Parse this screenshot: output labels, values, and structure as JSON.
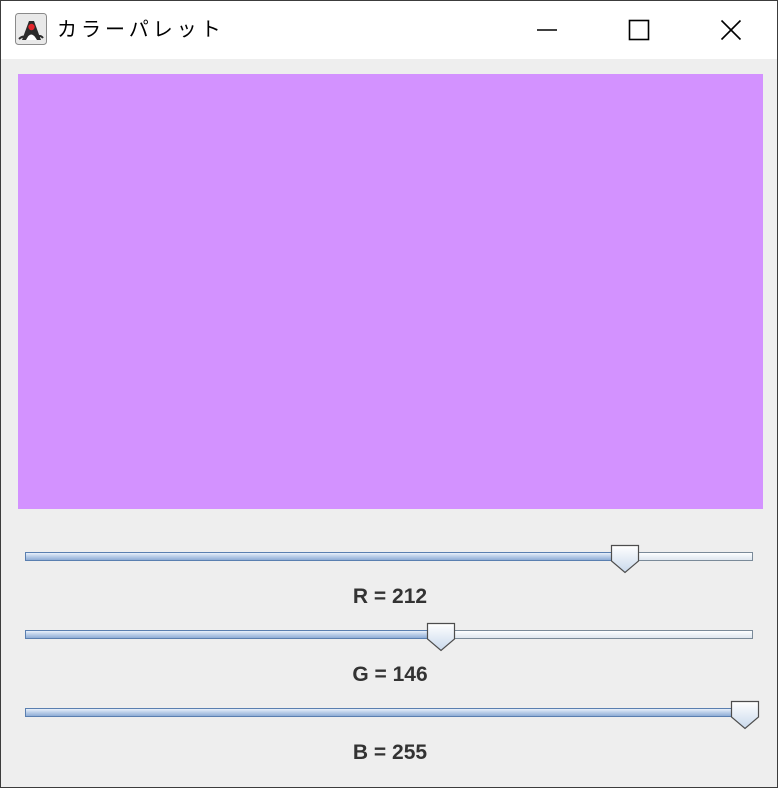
{
  "window": {
    "title": "カラーパレット",
    "app_icon": "java-duke-icon",
    "controls": [
      "minimize-icon",
      "maximize-icon",
      "close-icon"
    ]
  },
  "swatch": {
    "color": "#d392ff"
  },
  "sliders": [
    {
      "channel": "R",
      "value": 212,
      "max": 255,
      "label": "R = 212"
    },
    {
      "channel": "G",
      "value": 146,
      "max": 255,
      "label": "G = 146"
    },
    {
      "channel": "B",
      "value": 255,
      "max": 255,
      "label": "B = 255"
    }
  ]
}
